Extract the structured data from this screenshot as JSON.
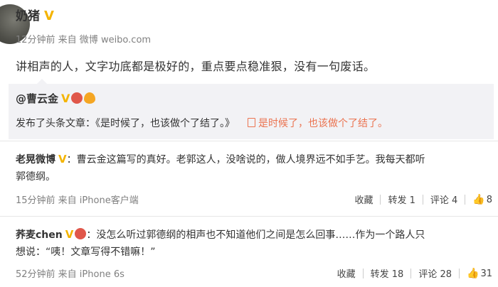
{
  "post": {
    "author": "奶猪",
    "verified_badge": "V",
    "meta": "12分钟前 来自 微博 weibo.com",
    "text": "讲相声的人，文字功底都是极好的，重点要点稳准狠，没有一句废话。"
  },
  "repost": {
    "author": "@曹云金",
    "verified_badge": "V",
    "text": "发布了头条文章：《是时候了，也该做个了结了。》",
    "article_link": "是时候了，也该做个了结了。"
  },
  "comments": [
    {
      "author": "老晃微博",
      "verified_badge": "V",
      "text_line1": "：曹云金这篇写的真好。老郭这人，没啥说的，做人境界远不如手艺。我每天都听",
      "text_line2": "郭德纲。",
      "meta": "15分钟前 来自 iPhone客户端",
      "actions": {
        "fav": "收藏",
        "repost": "转发 1",
        "comment": "评论 4",
        "like": "8"
      }
    },
    {
      "author": "荞麦chen",
      "verified_badge": "V",
      "text_line1": "：没怎么听过郭德纲的相声也不知道他们之间是怎么回事……作为一个路人只",
      "text_line2": "想说：“咦！文章写得不错嘛！”",
      "meta": "52分钟前 来自 iPhone 6s",
      "actions": {
        "fav": "收藏",
        "repost": "转发 18",
        "comment": "评论 28",
        "like": "31"
      }
    }
  ],
  "colors": {
    "verified": "#f4b400",
    "link": "#eb7350",
    "meta": "#808080"
  }
}
